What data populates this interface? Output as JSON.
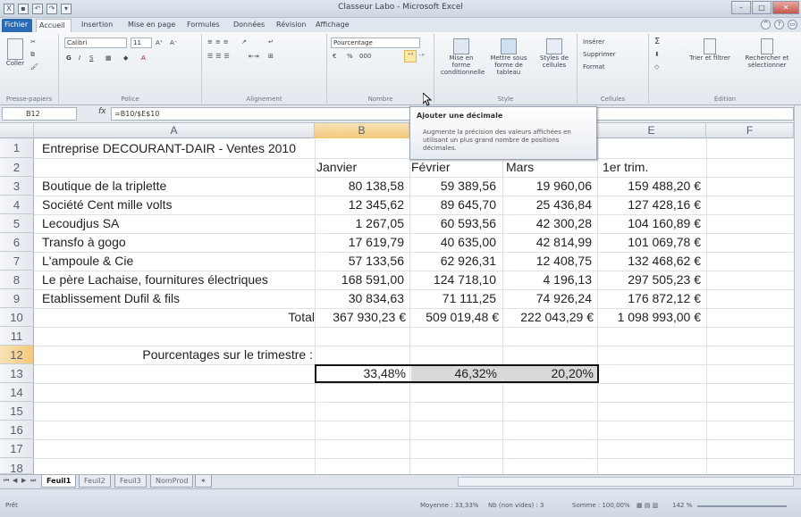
{
  "window": {
    "title": "Classeur Labo - Microsoft Excel"
  },
  "tabs": [
    "Fichier",
    "Accueil",
    "Insertion",
    "Mise en page",
    "Formules",
    "Données",
    "Révision",
    "Affichage"
  ],
  "ribbon": {
    "paste_label": "Coller",
    "font_name": "Calibri",
    "font_size": "11",
    "number_format": "Pourcentage",
    "percent_symbol": "%",
    "thousands": "000",
    "cond_format": "Mise en forme conditionnelle",
    "table_format": "Mettre sous forme de tableau",
    "cell_styles": "Styles de cellules",
    "insert": "Insérer",
    "delete": "Supprimer",
    "format": "Format",
    "sort_filter": "Trier et filtrer",
    "find_select": "Rechercher et sélectionner",
    "groups": [
      "Presse-papiers",
      "Police",
      "Alignement",
      "Nombre",
      "Style",
      "Cellules",
      "Édition"
    ]
  },
  "tooltip": {
    "title": "Ajouter une décimale",
    "body": "Augmente la précision des valeurs affichées en utilisant un plus grand nombre de positions décimales."
  },
  "formula_bar": {
    "name_box": "B12",
    "fx": "fx",
    "formula": "=B10/$E$10"
  },
  "columns": [
    "A",
    "B",
    "C",
    "D",
    "E",
    "F"
  ],
  "rows": [
    "1",
    "2",
    "3",
    "4",
    "5",
    "6",
    "7",
    "8",
    "9",
    "10",
    "11",
    "12",
    "13",
    "14",
    "15",
    "16",
    "17",
    "18"
  ],
  "sheet": {
    "title": "Entreprise DECOURANT-DAIR - Ventes 2010",
    "headers": [
      "Janvier",
      "Février",
      "Mars",
      "1er trim."
    ],
    "data": [
      {
        "name": "Boutique de la triplette",
        "b": "80 138,58",
        "c": "59 389,56",
        "d": "19 960,06",
        "e": "159 488,20 €"
      },
      {
        "name": "Société Cent mille volts",
        "b": "12 345,62",
        "c": "89 645,70",
        "d": "25 436,84",
        "e": "127 428,16 €"
      },
      {
        "name": "Lecoudjus SA",
        "b": "1 267,05",
        "c": "60 593,56",
        "d": "42 300,28",
        "e": "104 160,89 €"
      },
      {
        "name": "Transfo à gogo",
        "b": "17 619,79",
        "c": "40 635,00",
        "d": "42 814,99",
        "e": "101 069,78 €"
      },
      {
        "name": "L'ampoule & Cie",
        "b": "57 133,56",
        "c": "62 926,31",
        "d": "12 408,75",
        "e": "132 468,62 €"
      },
      {
        "name": "Le père Lachaise, fournitures électriques",
        "b": "168 591,00",
        "c": "124 718,10",
        "d": "4 196,13",
        "e": "297 505,23 €"
      },
      {
        "name": "Etablissement Dufil & fils",
        "b": "30 834,63",
        "c": "71 111,25",
        "d": "74 926,24",
        "e": "176 872,12 €"
      }
    ],
    "total_label": "Total",
    "totals": [
      "367 930,23 €",
      "509 019,48 €",
      "222 043,29 €",
      "1 098 993,00 €"
    ],
    "pct_label": "Pourcentages sur le trimestre :",
    "pcts": [
      "33,48%",
      "46,32%",
      "20,20%"
    ]
  },
  "sheet_tabs": [
    "Feuil1",
    "Feuil2",
    "Feuil3",
    "NomProd"
  ],
  "status": {
    "ready": "Prêt",
    "average": "Moyenne : 33,33%",
    "count": "Nb (non vides) : 3",
    "sum": "Somme : 100,00%",
    "zoom": "142 %"
  }
}
